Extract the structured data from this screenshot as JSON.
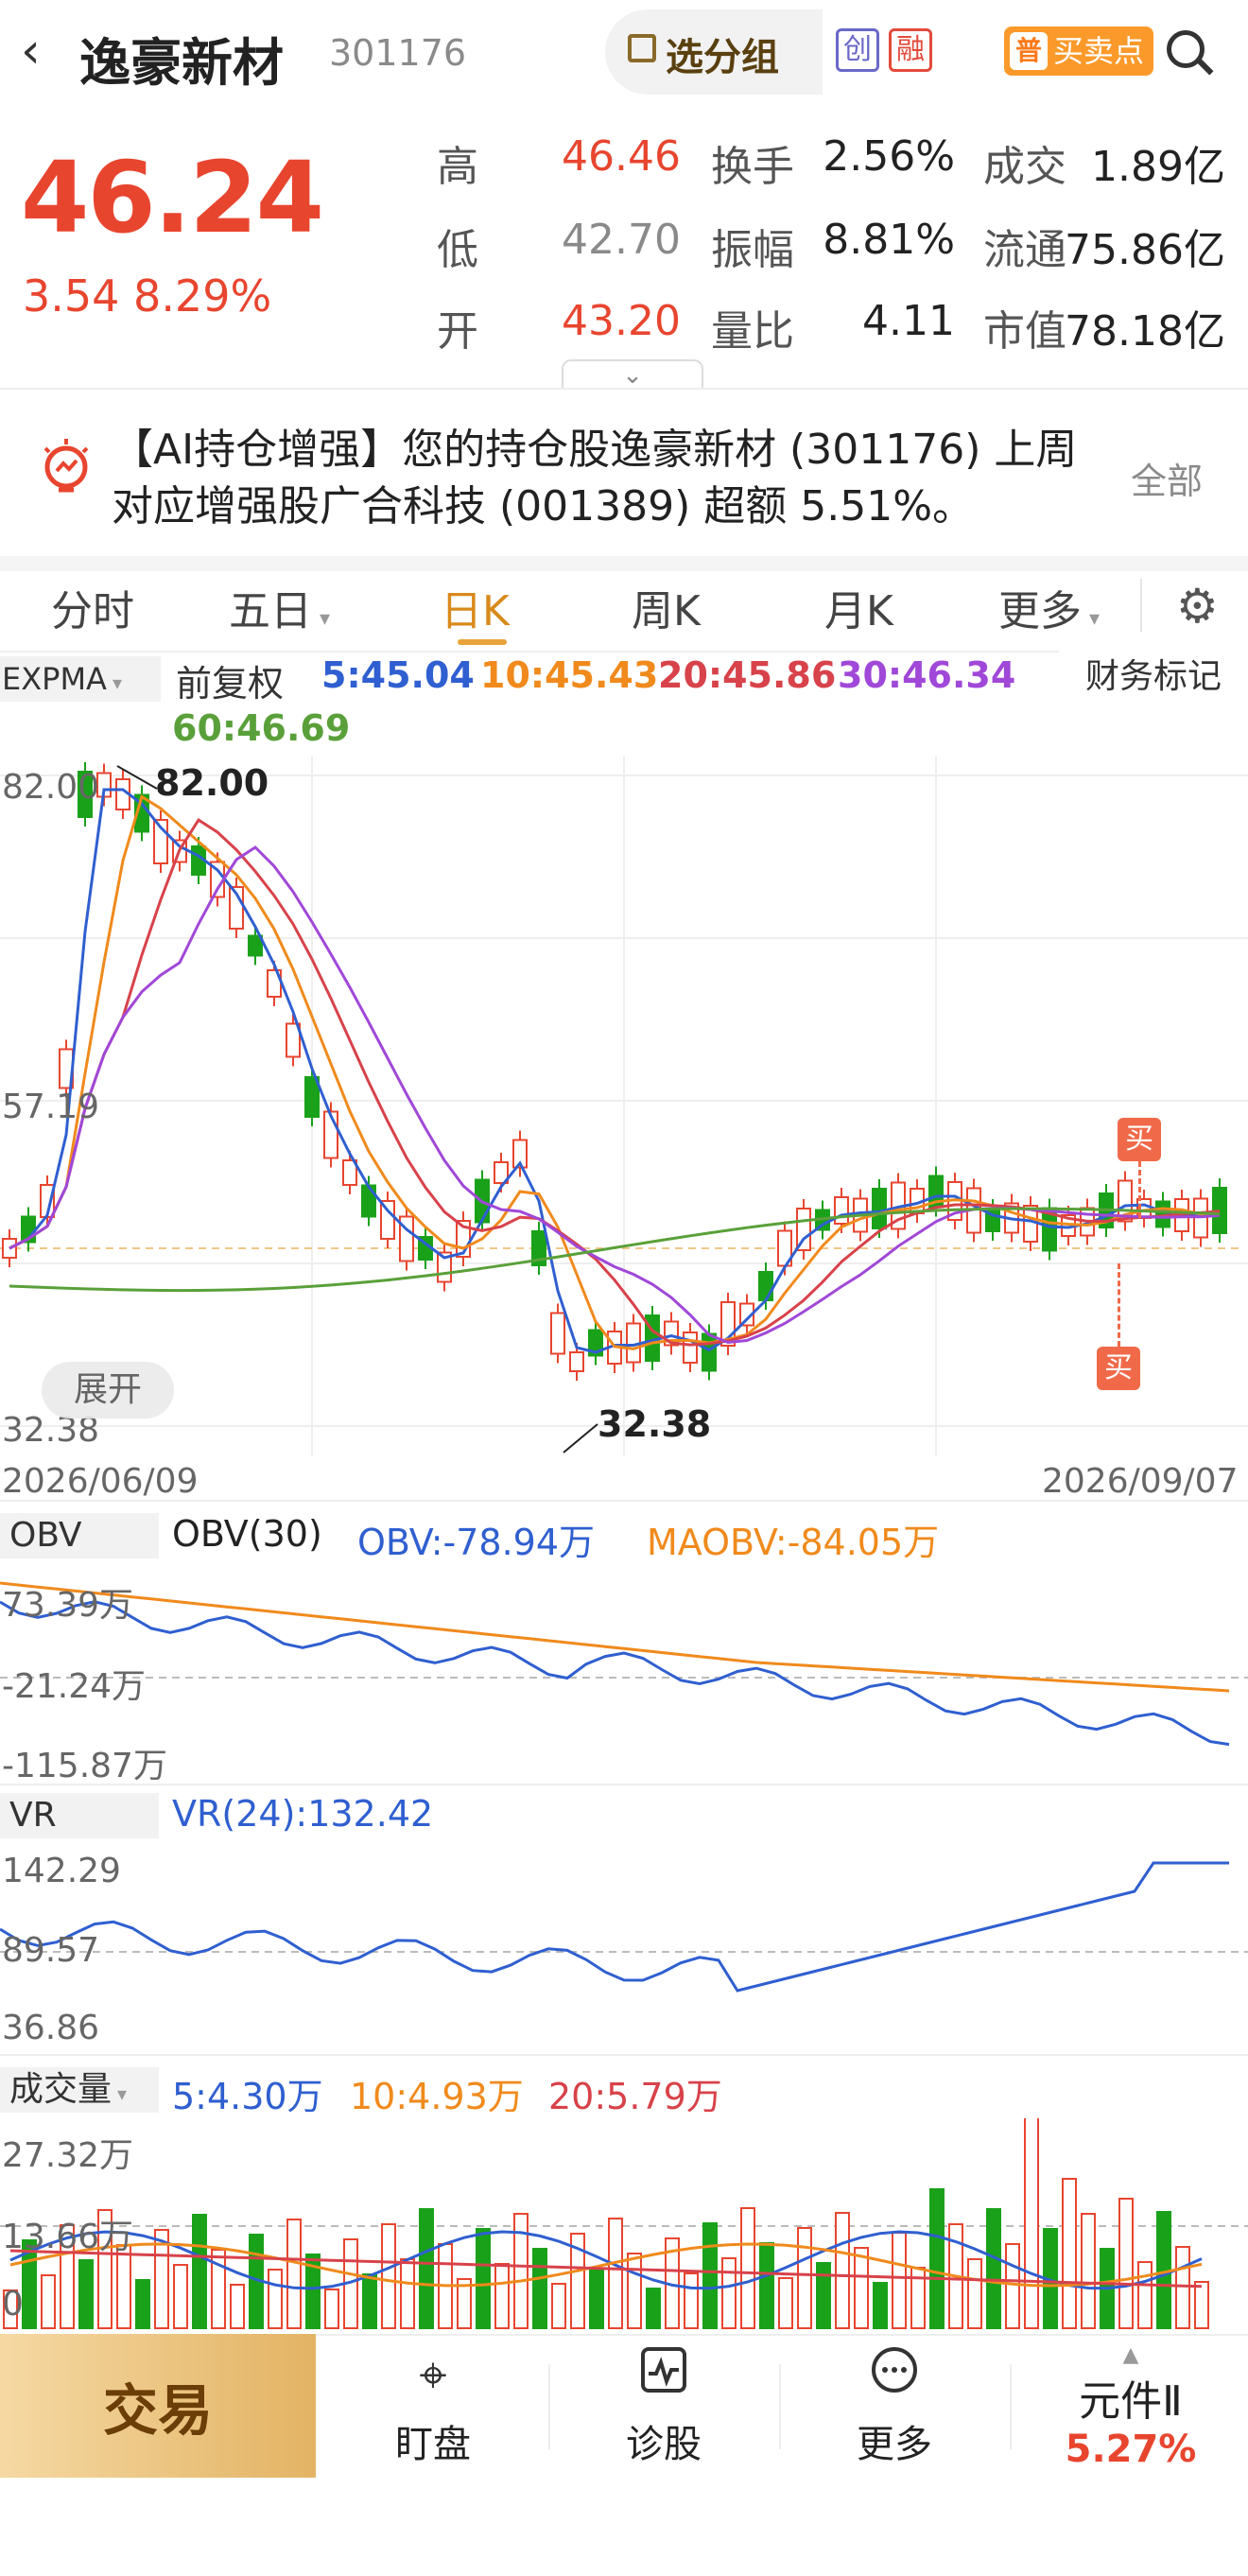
{
  "header": {
    "back_icon": "‹",
    "name": "逸豪新材",
    "code": "301176",
    "group_label": "选分组",
    "tag_chuang": "创",
    "tag_rong": "融",
    "buysell_badge": "普",
    "buysell_label": "买卖点"
  },
  "quote": {
    "price": "46.24",
    "change": "3.54",
    "change_pct": "8.29%",
    "labels": [
      "高",
      "换手",
      "成交",
      "低",
      "振幅",
      "流通",
      "开",
      "量比",
      "市值"
    ],
    "high": "46.46",
    "turnover": "2.56%",
    "amount": "1.89亿",
    "low": "42.70",
    "amplitude": "8.81%",
    "float_cap": "75.86亿",
    "open": "43.20",
    "vol_ratio": "4.11",
    "market_cap": "78.18亿",
    "colors": {
      "up": "#e8452f",
      "flat": "#8a8a8a",
      "down": "#1aa11a"
    }
  },
  "ai_news": {
    "text": "【AI持仓增强】您的持仓股逸豪新材 (301176) 上周对应增强股广合科技 (001389) 超额 5.51%。",
    "all_label": "全部",
    "icon": "bulb-icon"
  },
  "tabs": {
    "items": [
      "分时",
      "五日",
      "日K",
      "周K",
      "月K",
      "更多"
    ],
    "active": "日K",
    "settings_icon": "gear-icon"
  },
  "kline": {
    "indicator": "EXPMA",
    "adjust": "前复权",
    "legend": [
      {
        "label": "5:45.04",
        "color": "#2f5fd0"
      },
      {
        "label": "10:45.43",
        "color": "#f08a1c"
      },
      {
        "label": "20:45.86",
        "color": "#d8424a"
      },
      {
        "label": "30:46.34",
        "color": "#a048d8"
      },
      {
        "label": "60:46.69",
        "color": "#5aa03a"
      }
    ],
    "finance_mark": "财务标记",
    "y_top": "82.00",
    "y_mid": "57.19",
    "y_bottom": "32.38",
    "max_label": "82.00",
    "min_label": "32.38",
    "date_start": "2026/06/09",
    "date_end": "2026/09/07",
    "buy_label": "买",
    "unfold": "展开"
  },
  "obv": {
    "tag": "OBV",
    "title": "OBV(30)",
    "obv_label": "OBV:-78.94万",
    "maobv_label": "MAOBV:-84.05万",
    "y_top": "73.39万",
    "y_mid": "-21.24万",
    "y_bottom": "-115.87万"
  },
  "vr": {
    "tag": "VR",
    "title": "VR(24):132.42",
    "y_top": "142.29",
    "y_mid": "89.57",
    "y_bottom": "36.86"
  },
  "volume": {
    "tag": "成交量",
    "ma5": "5:4.30万",
    "ma10": "10:4.93万",
    "ma20": "20:5.79万",
    "y_top": "27.32万",
    "y_mid": "13.66万",
    "y_bottom": "0"
  },
  "bottom_nav": {
    "trade": "交易",
    "items": [
      {
        "label": "盯盘",
        "icon": "target-icon"
      },
      {
        "label": "诊股",
        "icon": "pulse-icon"
      },
      {
        "label": "更多",
        "icon": "more-icon"
      }
    ],
    "widget_label": "元件Ⅱ",
    "widget_pct": "5.27%"
  }
}
